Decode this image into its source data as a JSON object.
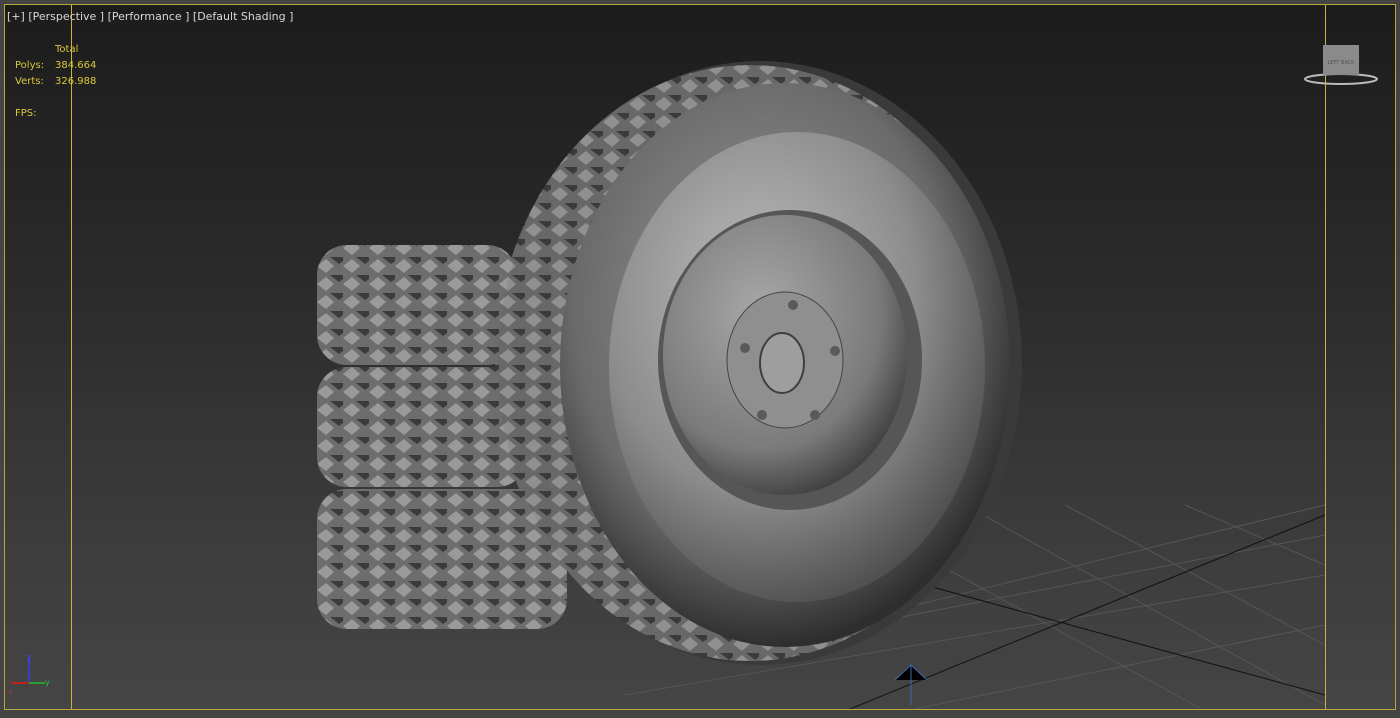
{
  "viewport": {
    "menu_plus": "[+]",
    "view": "[Perspective ]",
    "performance": "[Performance ]",
    "shading": "[Default Shading ]"
  },
  "stats": {
    "header": "Total",
    "polys_label": "Polys:",
    "polys_value": "384.664",
    "verts_label": "Verts:",
    "verts_value": "326.988",
    "fps_label": "FPS:"
  },
  "viewcube": {
    "label": "LEFT BACK"
  },
  "axis": {
    "x": "x",
    "y": "y",
    "z": "z"
  },
  "colors": {
    "frame": "#c9b43c",
    "stats_text": "#d9c93b",
    "label_text": "#d8d8d8"
  }
}
